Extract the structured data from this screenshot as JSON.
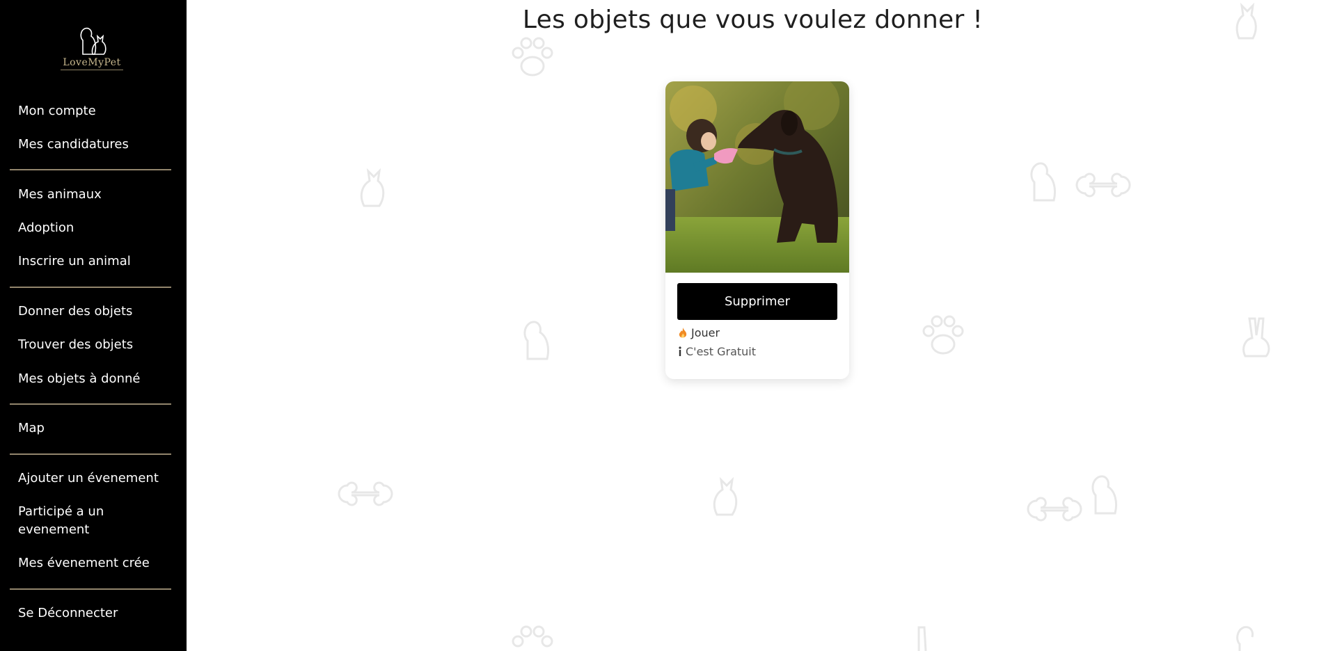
{
  "app": {
    "logo_text": "LoveMyPet"
  },
  "sidebar": {
    "items": [
      {
        "label": "Mon compte"
      },
      {
        "label": "Mes candidatures"
      },
      {
        "label": "Mes animaux"
      },
      {
        "label": "Adoption"
      },
      {
        "label": "Inscrire un animal"
      },
      {
        "label": "Donner des objets"
      },
      {
        "label": "Trouver des objets"
      },
      {
        "label": "Mes objets à donné"
      },
      {
        "label": "Map"
      },
      {
        "label": "Ajouter un évenement"
      },
      {
        "label": "Participé a un evenement"
      },
      {
        "label": "Mes évenement crée"
      },
      {
        "label": "Se Déconnecter"
      }
    ]
  },
  "main": {
    "title": "Les objets que vous voulez donner !",
    "items": [
      {
        "button_label": "Supprimer",
        "category": "Jouer",
        "price_text": "C'est Gratuit",
        "category_icon": "flame-icon",
        "price_icon": "info-icon"
      }
    ]
  },
  "colors": {
    "sidebar_bg": "#000000",
    "divider": "#b8a888",
    "button_bg": "#000000",
    "accent_gold": "#c9b98f"
  }
}
